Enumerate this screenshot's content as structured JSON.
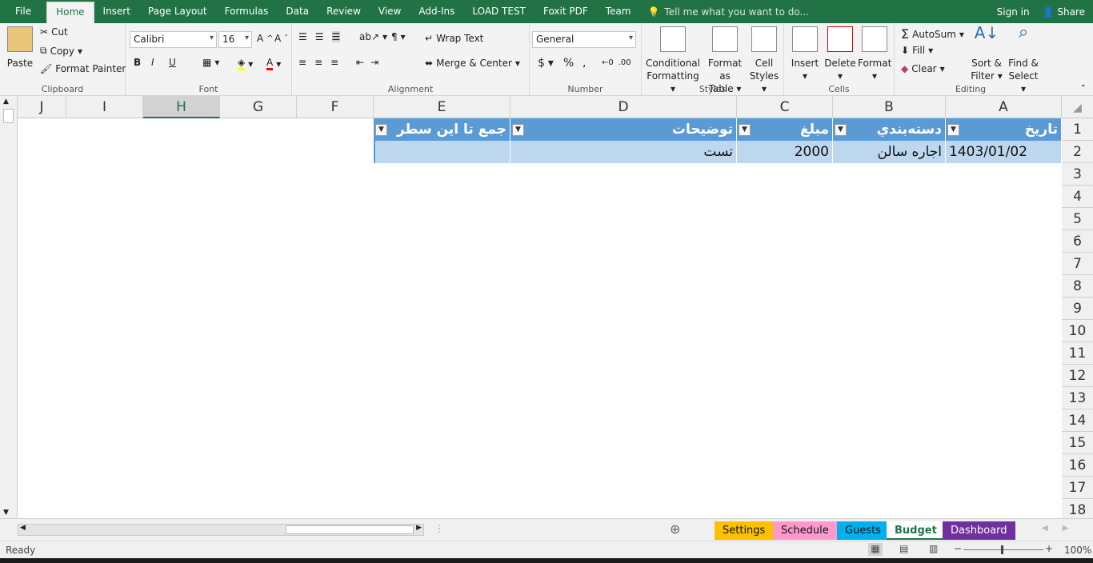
{
  "menu": {
    "file": "File",
    "tabs": [
      "Home",
      "Insert",
      "Page Layout",
      "Formulas",
      "Data",
      "Review",
      "View",
      "Add-Ins",
      "LOAD TEST",
      "Foxit PDF",
      "Team"
    ],
    "tell_me": "Tell me what you want to do...",
    "sign_in": "Sign in",
    "share": "Share"
  },
  "ribbon": {
    "clipboard": {
      "label": "Clipboard",
      "paste": "Paste",
      "cut": "Cut",
      "copy": "Copy",
      "format_painter": "Format Painter"
    },
    "font": {
      "label": "Font",
      "name": "Calibri",
      "size": "16",
      "bold": "B",
      "italic": "I",
      "underline": "U"
    },
    "alignment": {
      "label": "Alignment",
      "wrap": "Wrap Text",
      "merge": "Merge & Center"
    },
    "number": {
      "label": "Number",
      "format": "General",
      "dollar": "$",
      "percent": "%",
      "comma": ","
    },
    "styles": {
      "label": "Styles",
      "conditional_1": "Conditional",
      "conditional_2": "Formatting",
      "format_table_1": "Format as",
      "format_table_2": "Table",
      "cell_styles_1": "Cell",
      "cell_styles_2": "Styles"
    },
    "cells": {
      "label": "Cells",
      "insert": "Insert",
      "delete": "Delete",
      "format": "Format"
    },
    "editing": {
      "label": "Editing",
      "autosum": "AutoSum",
      "fill": "Fill",
      "clear": "Clear",
      "sort_1": "Sort &",
      "sort_2": "Filter",
      "find_1": "Find &",
      "find_2": "Select"
    }
  },
  "columns": [
    "J",
    "I",
    "H",
    "G",
    "F",
    "E",
    "D",
    "C",
    "B",
    "A"
  ],
  "selected_column": "H",
  "rows": [
    "1",
    "2",
    "3",
    "4",
    "5",
    "6",
    "7",
    "8",
    "9",
    "10",
    "11",
    "12",
    "13",
    "14",
    "15",
    "16",
    "17",
    "18"
  ],
  "table": {
    "headers": {
      "A": "تاریخ",
      "B": "دسته‌بندي",
      "C": "مبلغ",
      "D": "توضیحات",
      "E": "جمع تا این سطر"
    },
    "row2": {
      "A": "1403/01/02",
      "B": "اجاره سالن",
      "C": "2000",
      "D": "تست",
      "E": ""
    }
  },
  "sheets": [
    {
      "name": "Settings",
      "color": "#ffc000"
    },
    {
      "name": "Schedule",
      "color": "#ff99cc"
    },
    {
      "name": "Guests",
      "color": "#00b0f0"
    },
    {
      "name": "Budget",
      "color": "#ffffff",
      "active": true
    },
    {
      "name": "Dashboard",
      "color": "#7030a0"
    }
  ],
  "status": {
    "ready": "Ready",
    "zoom": "100%"
  }
}
